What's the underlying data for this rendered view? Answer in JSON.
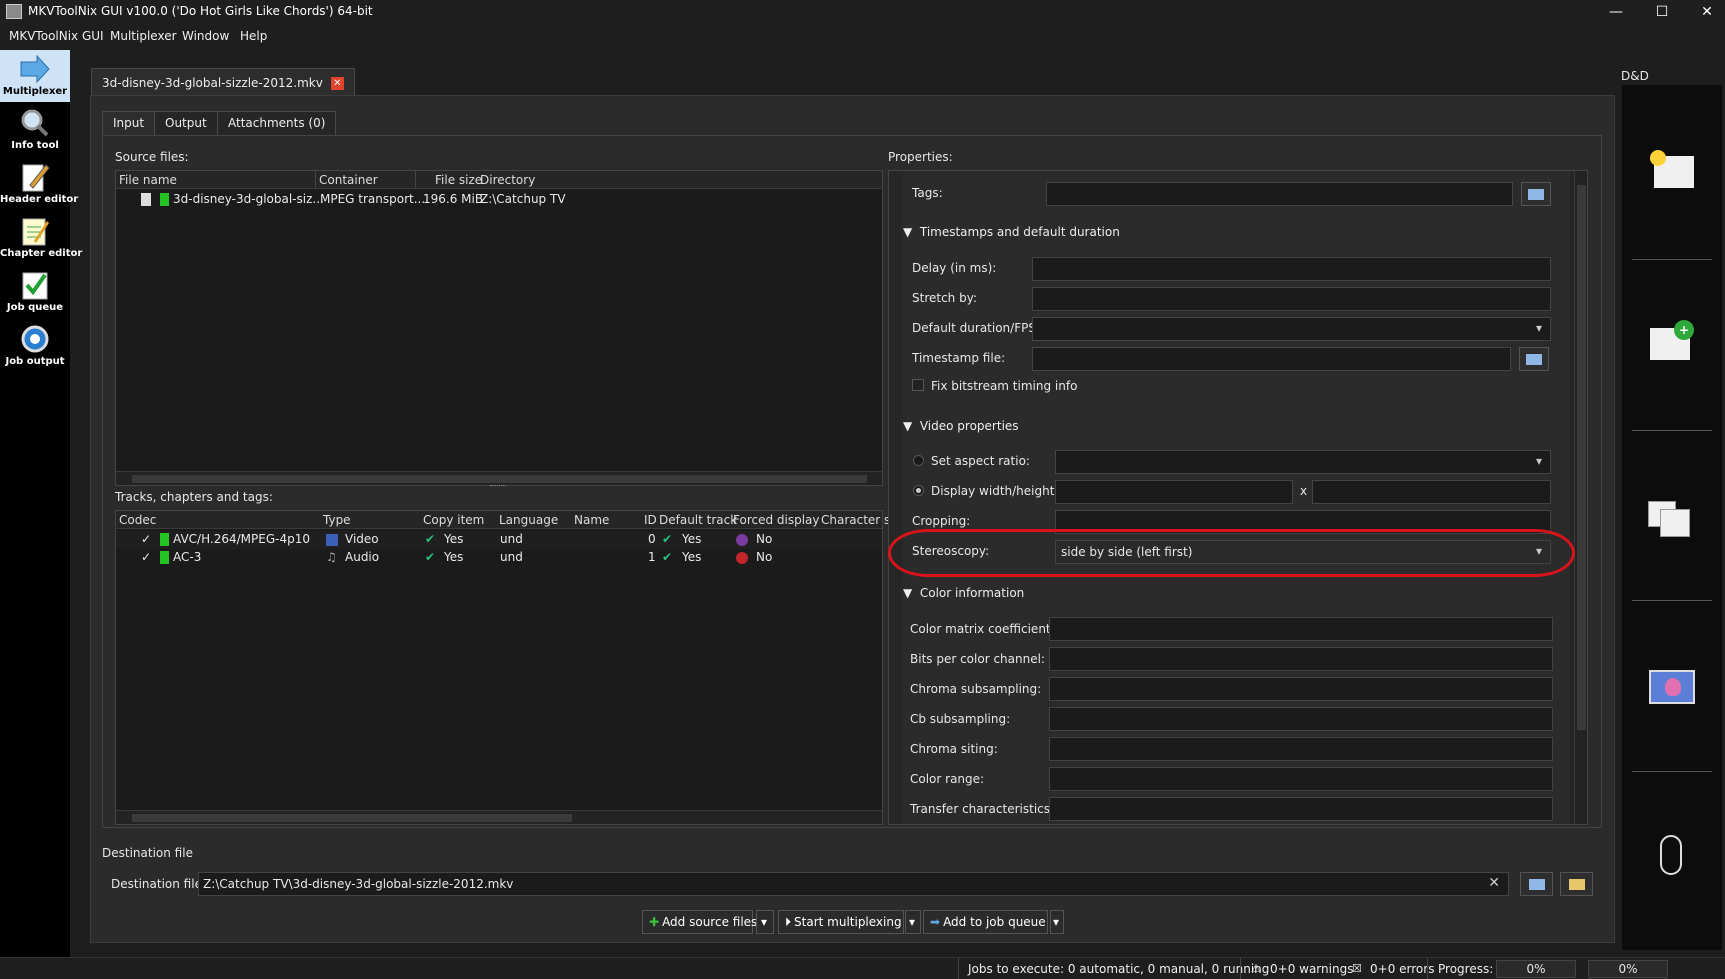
{
  "window": {
    "title": "MKVToolNix GUI v100.0 ('Do Hot Girls Like Chords') 64-bit",
    "controls": [
      "—",
      "☐",
      "✕"
    ]
  },
  "menu": [
    "MKVToolNix GUI",
    "Multiplexer",
    "Window",
    "Help"
  ],
  "tools": [
    {
      "label": "Multiplexer",
      "icon": "multiplexer-icon"
    },
    {
      "label": "Info tool",
      "icon": "info-tool-icon"
    },
    {
      "label": "Header editor",
      "icon": "header-editor-icon"
    },
    {
      "label": "Chapter editor",
      "icon": "chapter-editor-icon"
    },
    {
      "label": "Job queue",
      "icon": "job-queue-icon"
    },
    {
      "label": "Job output",
      "icon": "job-output-icon"
    }
  ],
  "doc_tab": "3d-disney-3d-global-sizzle-2012.mkv",
  "tabs": [
    "Input",
    "Output",
    "Attachments (0)"
  ],
  "source": {
    "label": "Source files:",
    "columns": [
      "File name",
      "Container",
      "File size",
      "Directory"
    ],
    "rows": [
      {
        "name": "3d-disney-3d-global-siz...",
        "container": "MPEG transport...",
        "size": "196.6 MiB",
        "dir": "Z:\\Catchup TV"
      }
    ]
  },
  "tracks": {
    "label": "Tracks, chapters and tags:",
    "columns": [
      "Codec",
      "Type",
      "Copy item",
      "Language",
      "Name",
      "ID",
      "Default track",
      "Forced display",
      "Character s"
    ],
    "rows": [
      {
        "codec": "AVC/H.264/MPEG-4p10",
        "type": "Video",
        "copy": "Yes",
        "lang": "und",
        "id": "0",
        "default": "Yes",
        "forced": "No"
      },
      {
        "codec": "AC-3",
        "type": "Audio",
        "copy": "Yes",
        "lang": "und",
        "id": "1",
        "default": "Yes",
        "forced": "No"
      }
    ]
  },
  "properties": {
    "label": "Properties:",
    "tags_label": "Tags:",
    "timestamps_header": "Timestamps and default duration",
    "delay_label": "Delay (in ms):",
    "stretch_label": "Stretch by:",
    "duration_label": "Default duration/FPS:",
    "tsfile_label": "Timestamp file:",
    "fix_bitstream": "Fix bitstream timing info",
    "video_header": "Video properties",
    "aspect_label": "Set aspect ratio:",
    "display_label": "Display width/height:",
    "x": "x",
    "cropping_label": "Cropping:",
    "stereo_label": "Stereoscopy:",
    "stereo_value": "side by side (left first)",
    "color_header": "Color information",
    "color_fields": [
      "Color matrix coefficients:",
      "Bits per color channel:",
      "Chroma subsampling:",
      "Cb subsampling:",
      "Chroma siting:",
      "Color range:",
      "Transfer characteristics:"
    ]
  },
  "destination": {
    "section": "Destination file",
    "label": "Destination file:",
    "value": "Z:\\Catchup TV\\3d-disney-3d-global-sizzle-2012.mkv"
  },
  "actions": {
    "add": "Add source files",
    "start": "Start multiplexing",
    "queue": "Add to job queue"
  },
  "dnd_label": "D&D",
  "status": {
    "jobs": "Jobs to execute:  0 automatic, 0 manual, 0 running",
    "warnings": "0+0 warnings",
    "errors": "0+0 errors",
    "progress_label": "Progress:",
    "progress1": "0%",
    "progress2": "0%"
  },
  "colors": {
    "highlight": "#d8141a",
    "track_green": "#22c322",
    "active_tool": "#cfe3f6"
  }
}
